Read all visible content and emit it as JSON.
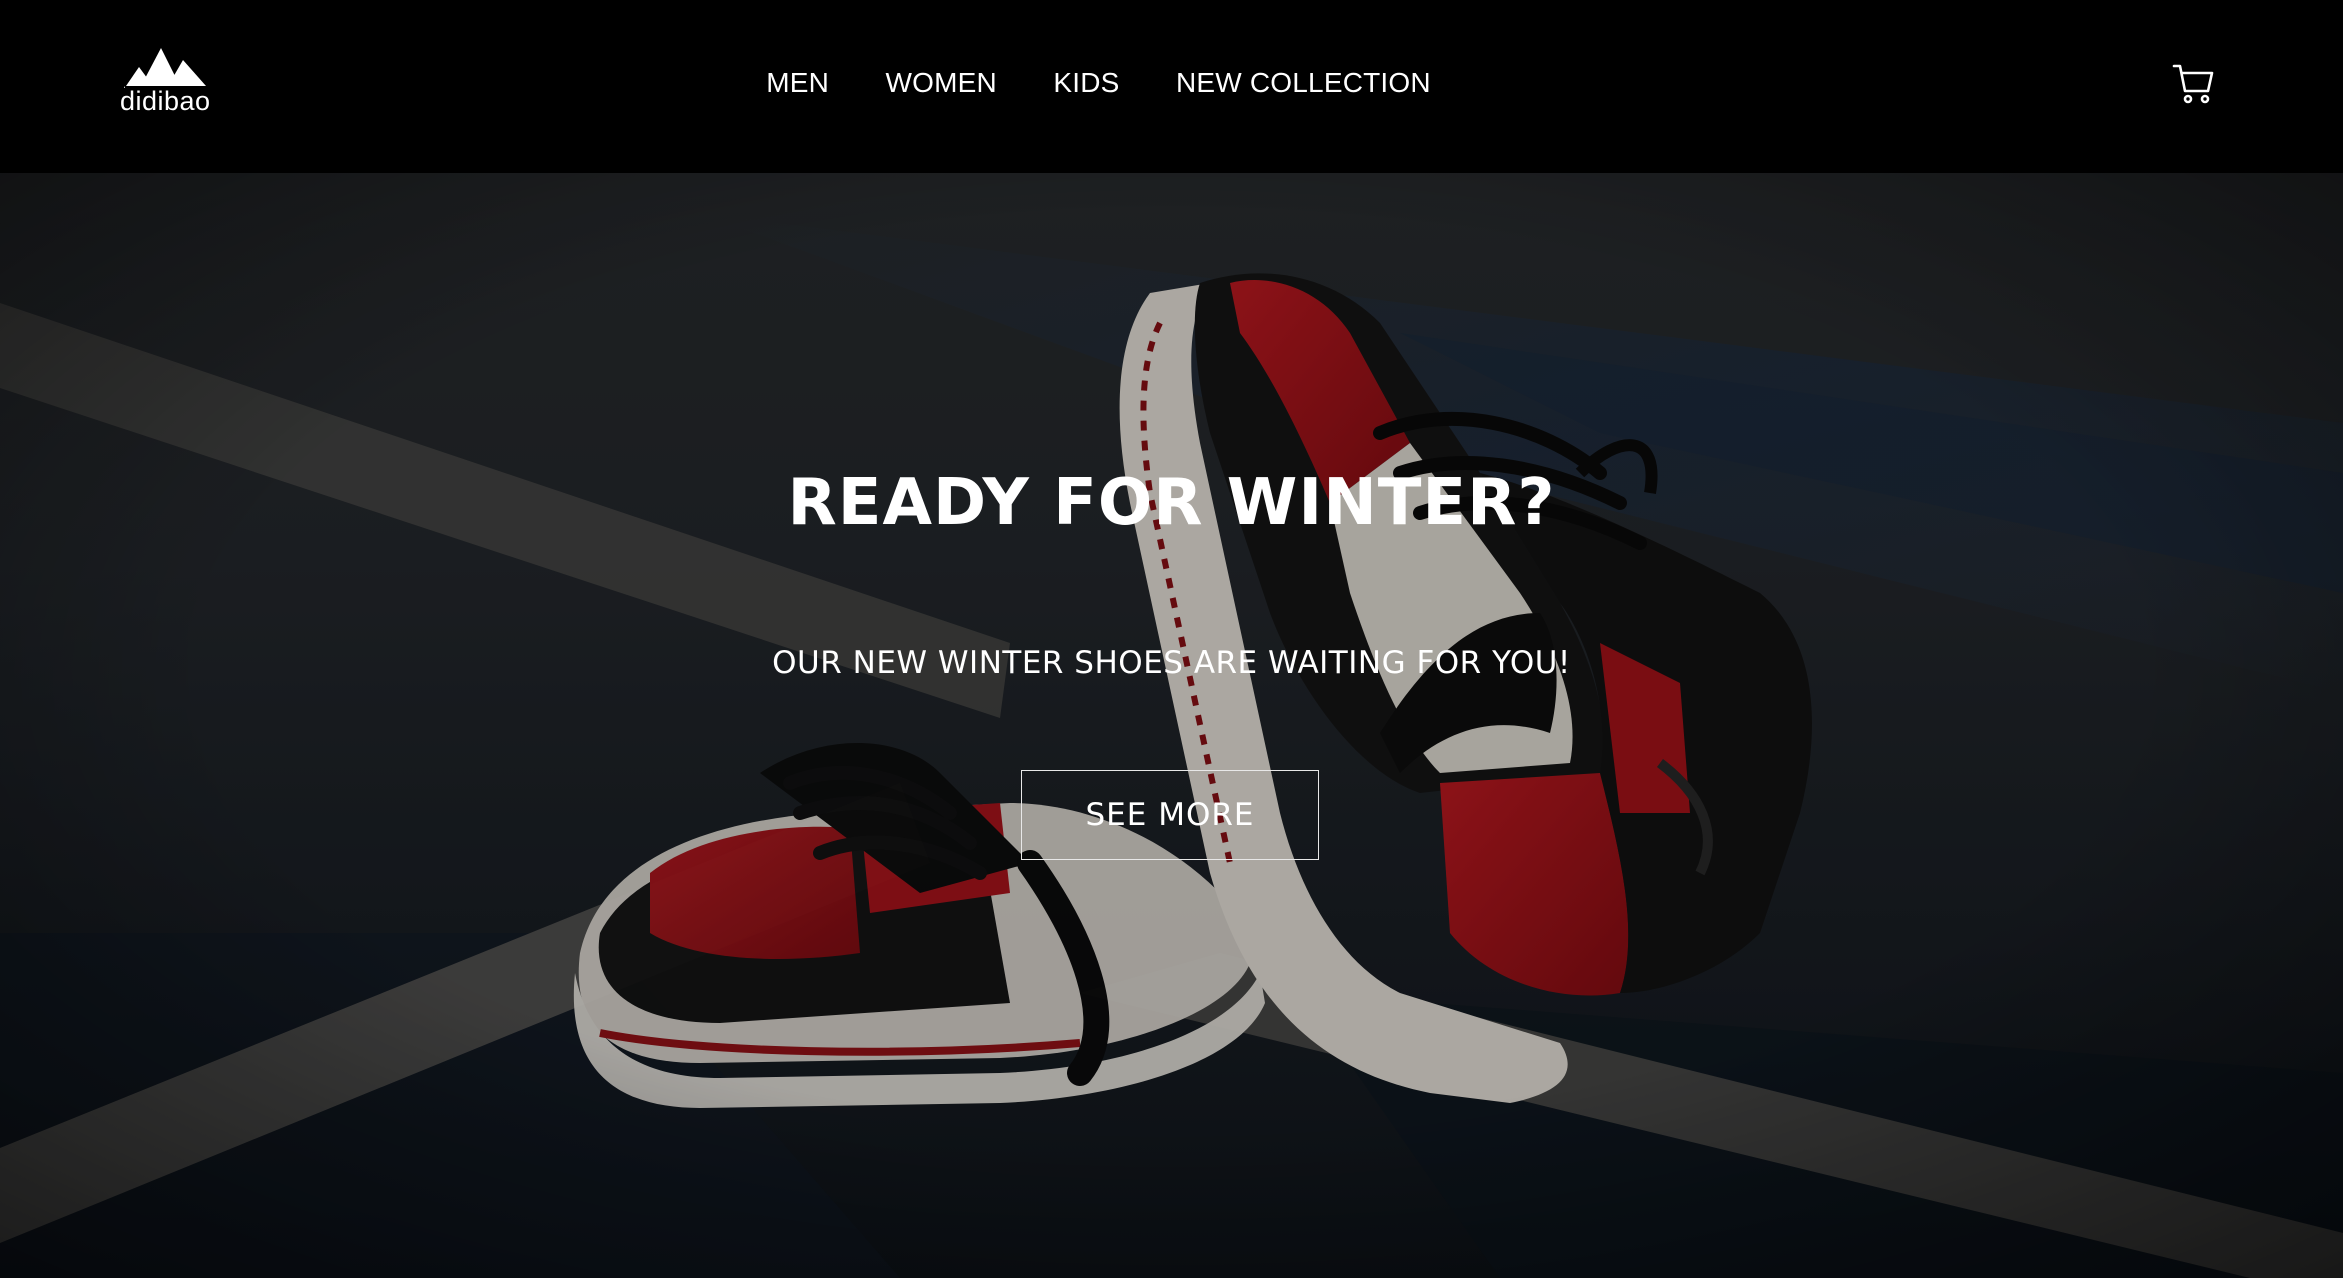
{
  "brand": {
    "name": "didibao",
    "logo_icon": "three-stripes-logo-icon"
  },
  "nav": {
    "items": [
      {
        "label": "MEN"
      },
      {
        "label": "WOMEN"
      },
      {
        "label": "KIDS"
      },
      {
        "label": "NEW COLLECTION"
      }
    ]
  },
  "cart": {
    "icon": "shopping-cart-icon"
  },
  "hero": {
    "title": "READY FOR WINTER?",
    "subtitle": "OUR NEW WINTER SHOES ARE WAITING FOR YOU!",
    "button_label": "SEE MORE",
    "image": "sneakers-photo"
  },
  "colors": {
    "header_bg": "#000000",
    "text": "#ffffff",
    "shoe_red": "#b5141c"
  }
}
